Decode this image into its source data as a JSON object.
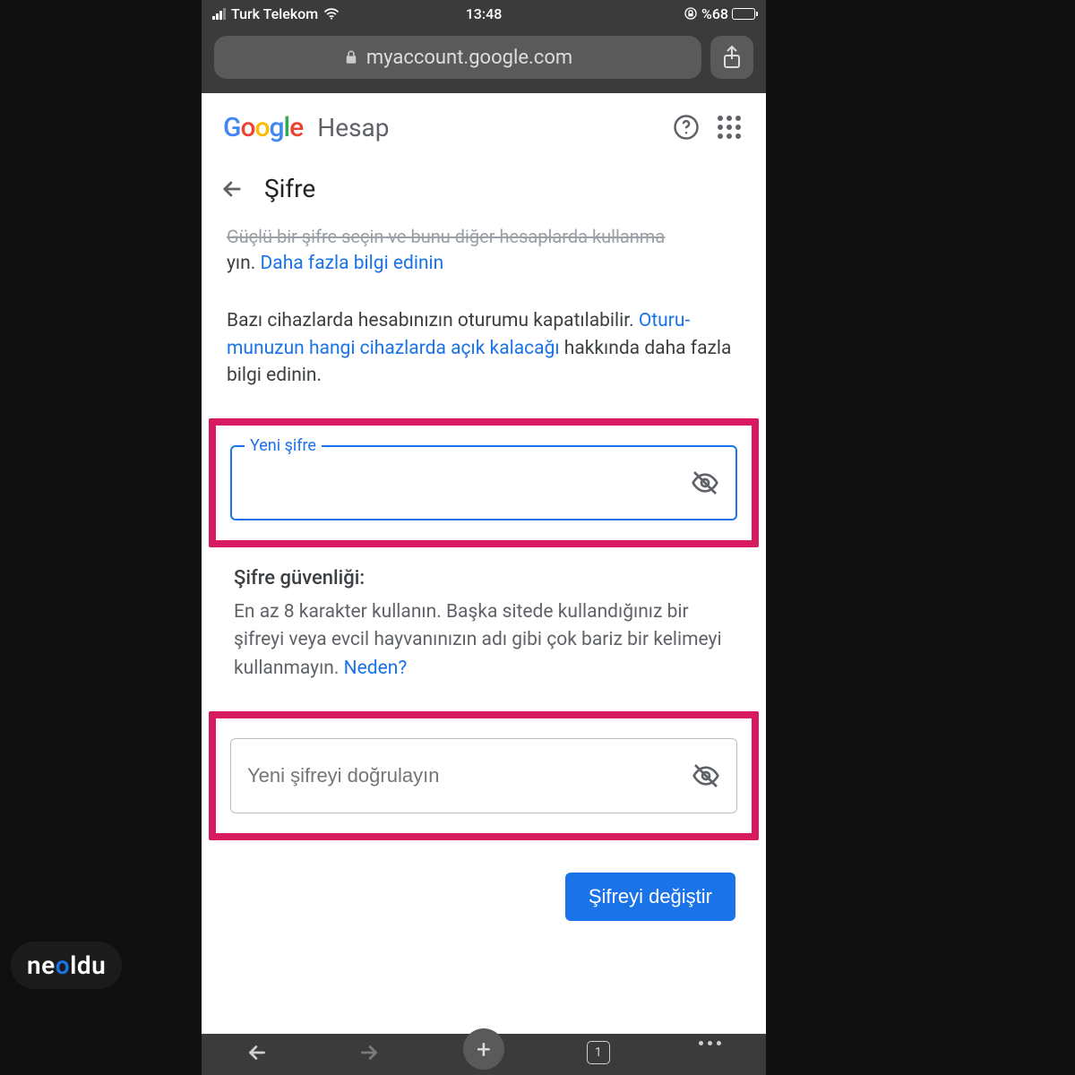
{
  "status": {
    "carrier": "Turk Telekom",
    "time": "13:48",
    "battery_pct": "%68"
  },
  "browser": {
    "url": "myaccount.google.com",
    "tab_count": "1"
  },
  "google_header": {
    "product": "Hesap"
  },
  "page": {
    "title": "Şifre",
    "top_truncated": "Güçlü bir şifre seçin ve bunu diğer hesaplarda kullanma",
    "para1_tail": "yın. ",
    "learn_more": "Daha fazla bilgi edinin",
    "para2_a": "Bazı cihazlarda hesabınızın oturumu kapatılabilir. ",
    "para2_link": "Oturu­munuzun hangi cihazlarda açık kalacağı",
    "para2_b": " hakkında daha fazla bilgi edinin."
  },
  "fields": {
    "new_password_label": "Yeni şifre",
    "confirm_placeholder": "Yeni şifreyi doğrulayın"
  },
  "strength": {
    "title": "Şifre güvenliği:",
    "body_a": "En az 8 karakter kullanın. Başka sitede kullandığınız bir şifreyi veya evcil hayvanınızın adı gibi çok bariz bir kelimeyi kullanmayın. ",
    "why": "Neden?"
  },
  "submit": {
    "label": "Şifreyi değiştir"
  },
  "watermark": {
    "pre": "ne",
    "o": "o",
    "post": "ldu"
  },
  "lock_symbol": "🔒"
}
